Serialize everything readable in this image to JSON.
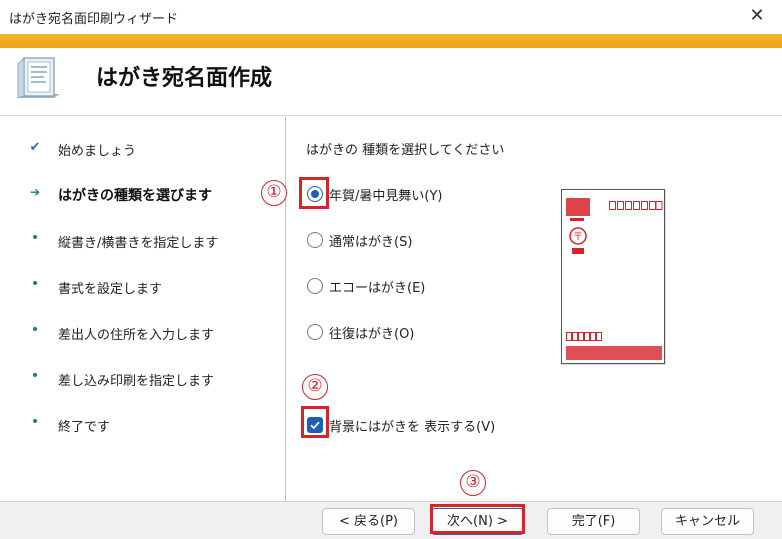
{
  "window": {
    "title": "はがき宛名面印刷ウィザード",
    "close_glyph": "✕"
  },
  "header": {
    "title": "はがき宛名面作成",
    "icon": "wizard-document-icon"
  },
  "colors": {
    "accent_bar": "#f0a316",
    "callout_red": "#d8232a",
    "selection_blue": "#1f5fb5",
    "step_green": "#1b8a3e"
  },
  "sidebar": {
    "steps": [
      {
        "label": "始めましょう",
        "state": "done",
        "glyph": "✔"
      },
      {
        "label": "はがきの種類を選びます",
        "state": "current",
        "glyph": "➔"
      },
      {
        "label": "縦書き/横書きを指定します",
        "state": "todo",
        "glyph": "•"
      },
      {
        "label": "書式を設定します",
        "state": "todo",
        "glyph": "•"
      },
      {
        "label": "差出人の住所を入力します",
        "state": "todo",
        "glyph": "•"
      },
      {
        "label": "差し込み印刷を指定します",
        "state": "todo",
        "glyph": "•"
      },
      {
        "label": "終了です",
        "state": "todo",
        "glyph": "•"
      }
    ]
  },
  "content": {
    "instruction": "はがきの 種類を選択してください",
    "options": [
      {
        "label": "年賀/暑中見舞い(Y)",
        "checked": true
      },
      {
        "label": "通常はがき(S)",
        "checked": false
      },
      {
        "label": "エコーはがき(E)",
        "checked": false
      },
      {
        "label": "往復はがき(O)",
        "checked": false
      }
    ],
    "show_background": {
      "label": "背景にはがきを 表示する(V)",
      "checked": true
    }
  },
  "callouts": [
    "①",
    "②",
    "③"
  ],
  "footer": {
    "back": "< 戻る(P)",
    "next": "次へ(N) >",
    "finish": "完了(F)",
    "cancel": "キャンセル"
  }
}
